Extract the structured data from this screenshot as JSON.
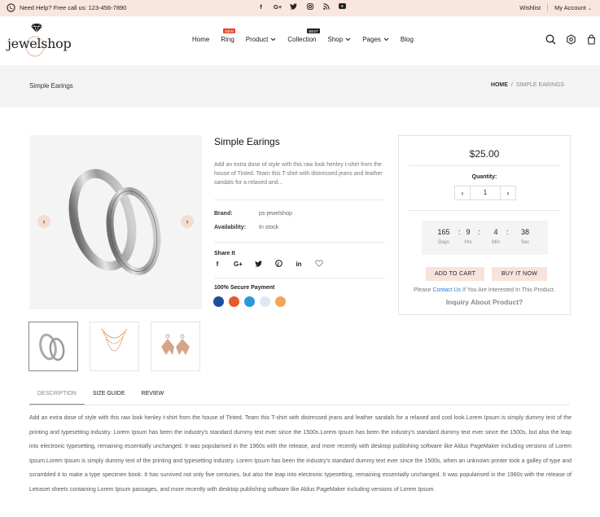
{
  "topbar": {
    "help_text": "Need Help? Free call us: 123-456-7890",
    "social": [
      "facebook-icon",
      "google-plus-icon",
      "twitter-icon",
      "instagram-icon",
      "rss-icon",
      "youtube-icon"
    ],
    "wishlist": "Wishlist",
    "account": "My Account"
  },
  "logo": {
    "text": "jewelshop"
  },
  "nav": {
    "items": [
      {
        "label": "Home"
      },
      {
        "label": "Ring",
        "badge": "NEW",
        "badge_color": "#e8412c"
      },
      {
        "label": "Product",
        "dropdown": true
      },
      {
        "label": "Collection",
        "badge": "BEST",
        "badge_color": "#222222"
      },
      {
        "label": "Shop",
        "dropdown": true
      },
      {
        "label": "Pages",
        "dropdown": true
      },
      {
        "label": "Blog"
      }
    ]
  },
  "header_icons": [
    "search-icon",
    "settings-icon",
    "cart-icon"
  ],
  "breadcrumb": {
    "page_title": "Simple Earings",
    "home": "HOME",
    "separator": "/",
    "current": "SIMPLE EARINGS"
  },
  "product": {
    "title": "Simple Earings",
    "description": "Add an extra dose of style with this raw look henley t-shirt from the house of Tinted. Team this T-shirt with distressed jeans and leather sandals for a relaxed and...",
    "brand_label": "Brand:",
    "brand_value": "ps-jewelshop",
    "availability_label": "Availability:",
    "availability_value": "In stock",
    "share_title": "Share It",
    "share_icons": [
      "facebook-icon",
      "google-plus-icon",
      "twitter-icon",
      "pinterest-icon",
      "linkedin-icon",
      "heart-icon"
    ],
    "secure_title": "100% Secure Payment",
    "payment_icons": [
      "visa-icon",
      "mastercard-icon",
      "maestro-icon",
      "paypal-icon",
      "discover-icon"
    ]
  },
  "buy_box": {
    "price": "$25.00",
    "quantity_label": "Quantity:",
    "quantity_value": "1",
    "timer": [
      {
        "value": "165",
        "label": "Days"
      },
      {
        "value": "9",
        "label": "Hrs"
      },
      {
        "value": "4",
        "label": "Min"
      },
      {
        "value": "38",
        "label": "Sec"
      }
    ],
    "add_to_cart": "ADD TO CART",
    "buy_now": "BUY IT NOW",
    "please_text": "Please",
    "contact_link": "Contact Us",
    "please_suffix": "If You Are Interested In This Product.",
    "inquiry": "Inquiry About Product?"
  },
  "tabs": {
    "items": [
      "DESCRIPTION",
      "SIZE GUIDE",
      "REVIEW"
    ],
    "active": 0
  },
  "description_text": "Add an extra dose of style with this raw look henley t-shirt from the house of Tinted. Team this T-shirt with distressed jeans and leather sandals for a relaxed and cool look.Lorem Ipsum is simply dummy text of the printing and typesetting industry. Lorem Ipsum has been the industry's standard dummy text ever since the 1500s.Lorem Ipsum has been the industry's standard dummy text ever since the 1500s, but also the leap into electronic typesetting, remaining essentially unchanged. It was popularised in the 1960s with the release, and more recently with desktop publishing software like Aldus PageMaker including versions of Lorem Ipsum.Lorem Ipsum is simply dummy text of the printing and typesetting industry. Lorem Ipsum has been the industry's standard dummy text ever since the 1500s, when an unknown printer took a galley of type and scrambled it to make a type specimen book. It has survived not only five centuries, but also the leap into electronic typesetting, remaining essentially unchanged. It was popularised in the 1960s with the release of Letraset sheets containing Lorem Ipsum passages, and more recently with desktop publishing software like Aldus PageMaker including versions of Lorem Ipsum."
}
